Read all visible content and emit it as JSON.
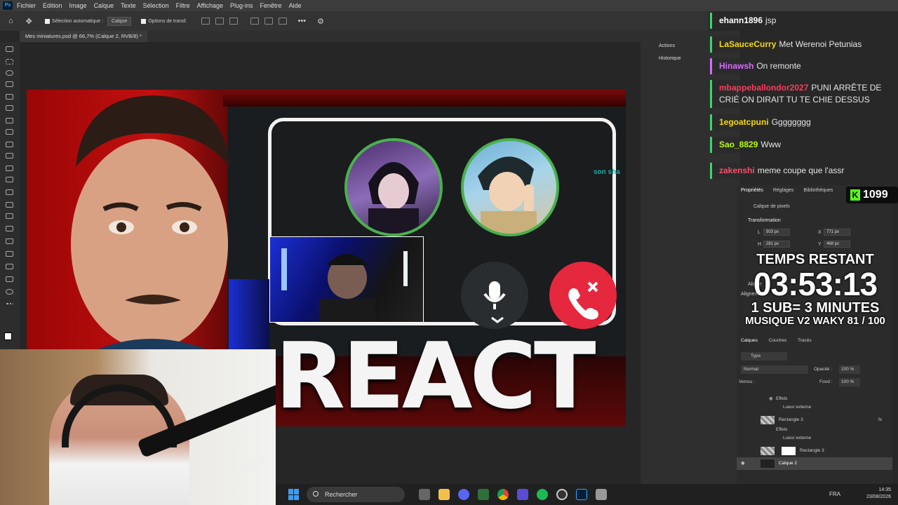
{
  "app": {
    "logo": "Ps"
  },
  "menu": [
    "Fichier",
    "Edition",
    "Image",
    "Calque",
    "Texte",
    "Sélection",
    "Filtre",
    "Affichage",
    "Plug-ins",
    "Fenêtre",
    "Aide"
  ],
  "options": {
    "auto_select": "Sélection automatique :",
    "auto_select_value": "Calque",
    "transform": "Options de transf."
  },
  "document_tab": "Mes miniatures.psd @ 66,7% (Calque 2, RVB/8) *",
  "side_panels": {
    "actions": "Actions",
    "history": "Historique"
  },
  "canvas": {
    "react_text": "REACT",
    "call_caption": "son sha"
  },
  "chat": [
    {
      "user": "ehann1896",
      "text": "jsp",
      "color": "#ffffff"
    },
    {
      "user": "LaSauceCurry",
      "text": "Met Werenoi Petunias",
      "color": "#f5d90a"
    },
    {
      "user": "Hinawsh",
      "text": "On remonte",
      "color": "#d66bff"
    },
    {
      "user": "mbappeballondor2027",
      "text": "PUNI ARRÊTE DE CRIÉ ON DIRAIT TU TE CHIE DESSUS",
      "color": "#ff3b5c"
    },
    {
      "user": "1egoatcpuni",
      "text": "Gggggggg",
      "color": "#f5d90a"
    },
    {
      "user": "Sao_8829",
      "text": "Www",
      "color": "#b6ff00"
    },
    {
      "user": "zakenshi",
      "text": "meme coupe que l'assr",
      "color": "#ff4d6d"
    }
  ],
  "kick": {
    "icon": "K",
    "count": "1099"
  },
  "properties": {
    "tabs": [
      "Propriétés",
      "Réglages",
      "Bibliothèques"
    ],
    "layer_type": "Calque de pixels",
    "transform_title": "Transformation",
    "w_label": "L",
    "w": "503 px",
    "h_label": "H",
    "h": "281 px",
    "x_label": "X",
    "x": "771 px",
    "y_label": "Y",
    "y": "468 px",
    "align_title": "Aligne",
    "align_sub": "Alignement"
  },
  "timer": {
    "label": "TEMPS RESTANT",
    "time": "03:53:13",
    "rule": "1 SUB= 3 MINUTES",
    "music": "MUSIQUE V2 WAKY 81 / 100"
  },
  "layers": {
    "tabs": [
      "Calques",
      "Couches",
      "Tracés"
    ],
    "filter": "Type",
    "blend": "Normal",
    "opacity_label": "Opacité :",
    "opacity": "100 %",
    "lock_label": "Verrou :",
    "fill_label": "Fond :",
    "fill": "100 %",
    "rows": [
      {
        "name": "Effets"
      },
      {
        "name": "Lueur externe"
      },
      {
        "name": "Rectangle 3"
      },
      {
        "name": "Effets"
      },
      {
        "name": "Lueur externe"
      },
      {
        "name": "Rectangle 3"
      },
      {
        "name": "Calque 2"
      }
    ]
  },
  "taskbar": {
    "search": "Rechercher",
    "lang": "FRA",
    "time": "14:35",
    "date": "23/08/2026"
  }
}
